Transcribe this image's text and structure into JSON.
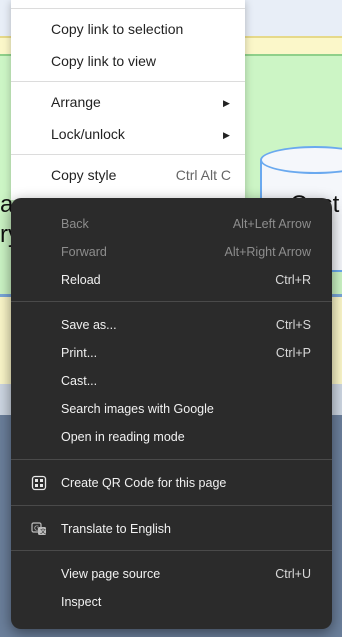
{
  "background": {
    "left_text_line1": "a",
    "left_text_line2": "ry",
    "right_text_line1": "Cust",
    "right_text_line2": "og"
  },
  "light_menu": {
    "items": [
      {
        "label": "Copy link to selection"
      },
      {
        "label": "Copy link to view"
      },
      {
        "label": "Arrange",
        "submenu": true
      },
      {
        "label": "Lock/unlock",
        "submenu": true
      },
      {
        "label": "Copy style",
        "shortcut": "Ctrl Alt C"
      }
    ],
    "arrow_glyph": "▶"
  },
  "dark_menu": {
    "groups": [
      [
        {
          "label": "Back",
          "shortcut": "Alt+Left Arrow",
          "disabled": true
        },
        {
          "label": "Forward",
          "shortcut": "Alt+Right Arrow",
          "disabled": true
        },
        {
          "label": "Reload",
          "shortcut": "Ctrl+R"
        }
      ],
      [
        {
          "label": "Save as...",
          "shortcut": "Ctrl+S"
        },
        {
          "label": "Print...",
          "shortcut": "Ctrl+P"
        },
        {
          "label": "Cast..."
        },
        {
          "label": "Search images with Google"
        },
        {
          "label": "Open in reading mode"
        }
      ],
      [
        {
          "label": "Create QR Code for this page",
          "icon": "qr-code-icon"
        }
      ],
      [
        {
          "label": "Translate to English",
          "icon": "translate-icon"
        }
      ],
      [
        {
          "label": "View page source",
          "shortcut": "Ctrl+U"
        },
        {
          "label": "Inspect"
        }
      ]
    ]
  },
  "colors": {
    "dark_menu_bg": "#2b2b2b",
    "green_area": "#ccf5c5",
    "yellow_strip": "#fbf7c9",
    "shape_stroke": "#6aa9ef"
  }
}
